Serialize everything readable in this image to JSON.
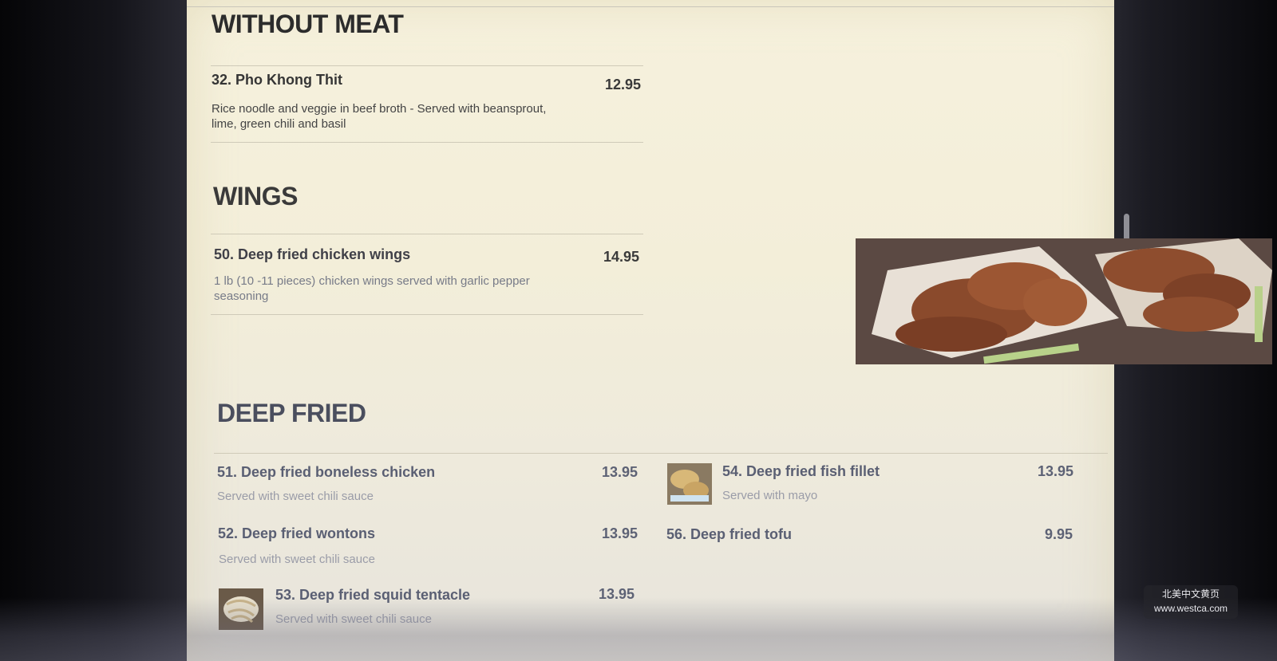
{
  "sections": {
    "without_meat": {
      "title": "WITHOUT MEAT",
      "items": [
        {
          "name": "32. Pho Khong Thit",
          "price": "12.95",
          "desc": "Rice noodle and veggie in beef broth - Served with beansprout, lime, green chili and basil"
        }
      ]
    },
    "wings": {
      "title": "WINGS",
      "items": [
        {
          "name": "50. Deep fried chicken wings",
          "price": "14.95",
          "desc": "1 lb (10 -11 pieces) chicken wings served with garlic pepper seasoning"
        }
      ]
    },
    "deep_fried": {
      "title": "DEEP FRIED",
      "items": [
        {
          "name": "51. Deep fried boneless chicken",
          "price": "13.95",
          "desc": "Served with sweet chili sauce"
        },
        {
          "name": "52. Deep fried wontons",
          "price": "13.95",
          "desc": "Served with sweet chili sauce"
        },
        {
          "name": "53. Deep fried squid tentacle",
          "price": "13.95",
          "desc": "Served with sweet chili sauce"
        },
        {
          "name": "54. Deep fried fish fillet",
          "price": "13.95",
          "desc": "Served with mayo"
        },
        {
          "name": "56. Deep fried tofu",
          "price": "9.95",
          "desc": ""
        }
      ]
    }
  },
  "watermark": {
    "line1": "北美中文黄页",
    "line2": "www.westca.com"
  }
}
